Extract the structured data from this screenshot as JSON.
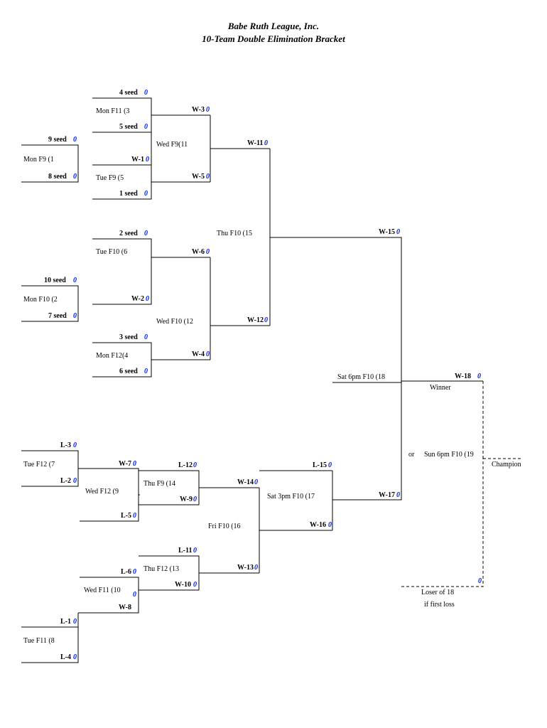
{
  "header": {
    "title1": "Babe Ruth League, Inc.",
    "title2": "10-Team Double Elimination Bracket"
  },
  "zero": "0",
  "labels": {
    "s4": "4 seed",
    "s5": "5 seed",
    "s9": "9 seed",
    "s8": "8 seed",
    "s1": "1 seed",
    "s2": "2 seed",
    "s10": "10 seed",
    "s7": "7 seed",
    "s3": "3 seed",
    "s6": "6 seed",
    "w1": "W-1",
    "w2": "W-2",
    "w3": "W-3",
    "w4": "W-4",
    "w5": "W-5",
    "w6": "W-6",
    "w7": "W-7",
    "w8": "W-8",
    "w9": "W-9",
    "w10": "W-10",
    "w11": "W-11",
    "w12": "W-12",
    "w13": "W-13",
    "w14": "W-14",
    "w15": "W-15",
    "w16": "W-16",
    "w17": "W-17",
    "w18": "W-18",
    "l1": "L-1",
    "l2": "L-2",
    "l3": "L-3",
    "l4": "L-4",
    "l5": "L-5",
    "l6": "L-6",
    "l11": "L-11",
    "l12": "L-12",
    "l15": "L-15"
  },
  "games": {
    "g1": "Mon F9 (1",
    "g2": "Mon F10 (2",
    "g3": "Mon F11 (3",
    "g4": "Mon F12(4",
    "g5": "Tue F9 (5",
    "g6": "Tue F10 (6",
    "g7": "Tue F12 (7",
    "g8": "Tue F11 (8",
    "g9": "Wed F12 (9",
    "g10": "Wed F11 (10",
    "g11": "Wed F9(11",
    "g12": "Wed F10 (12",
    "g13": "Thu F12 (13",
    "g14": "Thu F9 (14",
    "g15": "Thu F10 (15",
    "g16": "Fri F10 (16",
    "g17": "Sat 3pm F10 (17",
    "g18": "Sat 6pm F10 (18",
    "g19": "Sun 6pm F10 (19"
  },
  "text": {
    "winner": "Winner",
    "or": "or",
    "champion": "Champion",
    "loser18": "Loser of 18",
    "iffirst": "if first loss"
  }
}
